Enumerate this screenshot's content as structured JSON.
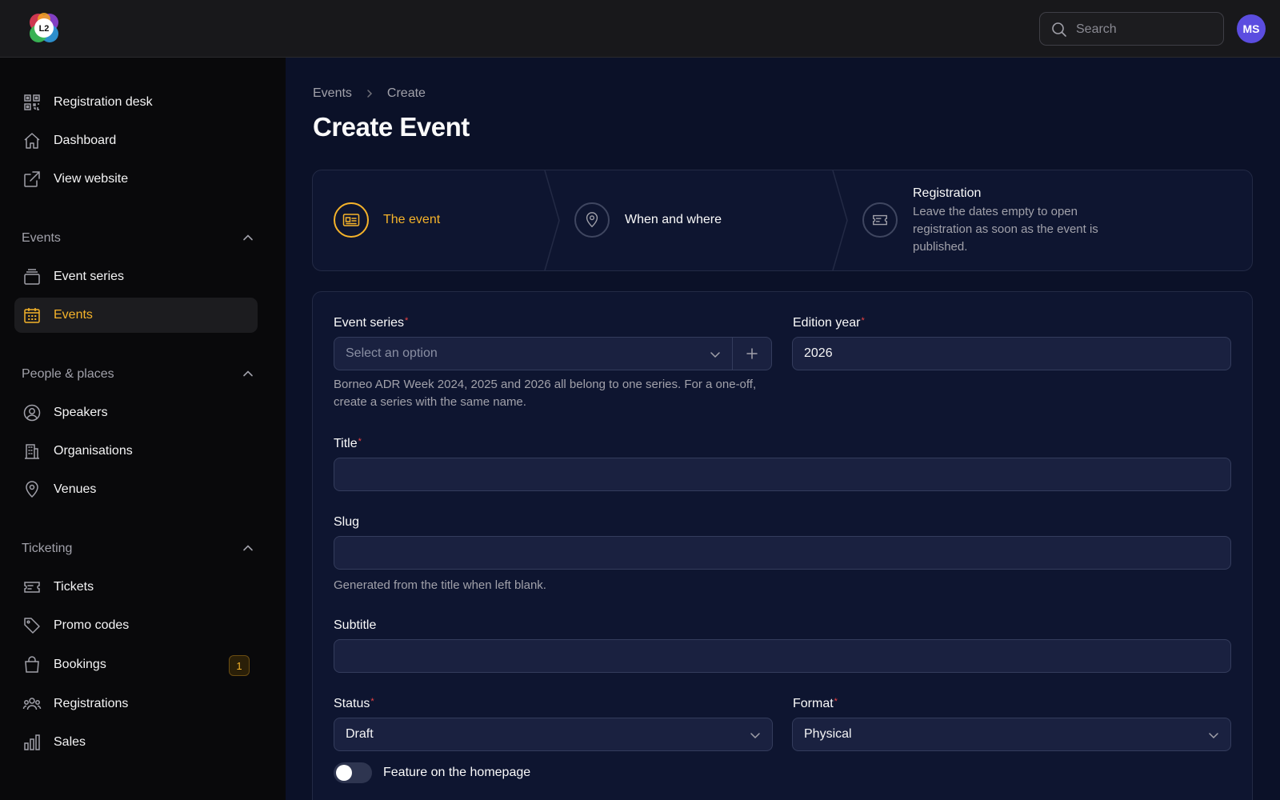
{
  "topbar": {
    "logo_text": "L2",
    "search_placeholder": "Search",
    "avatar_initials": "MS"
  },
  "sidebar": {
    "top_items": [
      {
        "label": "Registration desk",
        "icon": "qr-code-icon"
      },
      {
        "label": "Dashboard",
        "icon": "home-icon"
      },
      {
        "label": "View website",
        "icon": "external-link-icon"
      }
    ],
    "groups": [
      {
        "title": "Events",
        "items": [
          {
            "label": "Event series",
            "icon": "stack-icon"
          },
          {
            "label": "Events",
            "icon": "calendar-icon",
            "active": true
          }
        ]
      },
      {
        "title": "People & places",
        "items": [
          {
            "label": "Speakers",
            "icon": "user-circle-icon"
          },
          {
            "label": "Organisations",
            "icon": "building-icon"
          },
          {
            "label": "Venues",
            "icon": "map-pin-icon"
          }
        ]
      },
      {
        "title": "Ticketing",
        "items": [
          {
            "label": "Tickets",
            "icon": "ticket-icon"
          },
          {
            "label": "Promo codes",
            "icon": "tag-icon"
          },
          {
            "label": "Bookings",
            "icon": "shopping-bag-icon",
            "badge": "1"
          },
          {
            "label": "Registrations",
            "icon": "users-icon"
          },
          {
            "label": "Sales",
            "icon": "bar-chart-icon"
          }
        ]
      }
    ]
  },
  "main": {
    "breadcrumb": [
      "Events",
      "Create"
    ],
    "title": "Create Event",
    "steps": [
      {
        "title": "The event",
        "icon": "id-card-icon",
        "active": true
      },
      {
        "title": "When and where",
        "icon": "map-pin-icon"
      },
      {
        "title": "Registration",
        "icon": "ticket-icon",
        "description": "Leave the dates empty to open registration as soon as the event is published."
      }
    ],
    "form": {
      "event_series": {
        "label": "Event series",
        "placeholder": "Select an option",
        "help": "Borneo ADR Week 2024, 2025 and 2026 all belong to one series. For a one-off, create a series with the same name."
      },
      "edition_year": {
        "label": "Edition year",
        "value": "2026"
      },
      "title": {
        "label": "Title",
        "value": ""
      },
      "slug": {
        "label": "Slug",
        "value": "",
        "help": "Generated from the title when left blank."
      },
      "subtitle": {
        "label": "Subtitle",
        "value": ""
      },
      "status": {
        "label": "Status",
        "value": "Draft"
      },
      "format": {
        "label": "Format",
        "value": "Physical"
      },
      "feature_toggle": {
        "label": "Feature on the homepage",
        "on": false
      }
    }
  },
  "colors": {
    "accent": "#f5b32a",
    "required": "#ef4444",
    "avatar": "#5b4de0"
  }
}
